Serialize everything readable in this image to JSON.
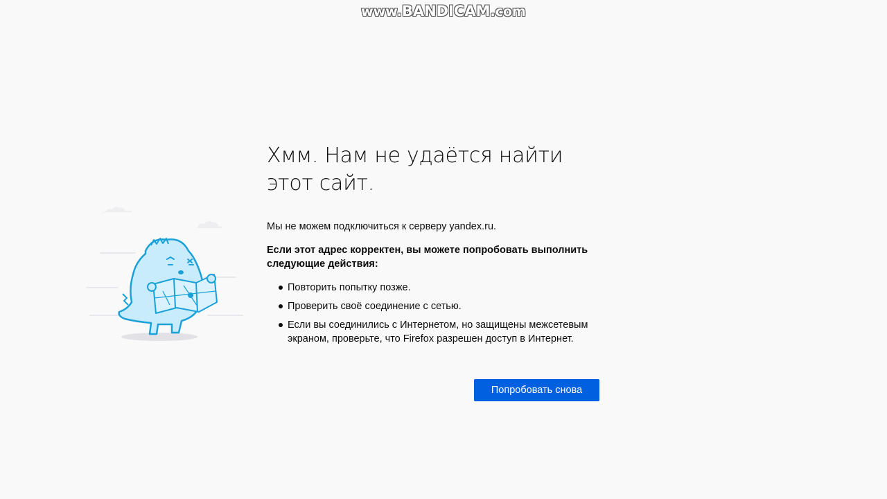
{
  "watermark": {
    "prefix": "www.",
    "brand": "BANDICAM",
    "suffix": ".com"
  },
  "error_page": {
    "title": "Хмм. Нам не удаётся найти этот сайт.",
    "lead": "Мы не можем подключиться к серверу yandex.ru.",
    "advice_heading": "Если этот адрес корректен, вы можете попробовать выполнить следующие действия:",
    "steps": [
      "Повторить попытку позже.",
      "Проверить своё соединение с сетью.",
      "Если вы соединились с Интернетом, но защищены межсетевым экраном, проверьте, что Firefox разрешен доступ в Интернет."
    ],
    "retry_button": "Попробовать снова"
  },
  "colors": {
    "background": "#f9f9fa",
    "button": "#0060df",
    "illustration_fill": "#c8ecfb",
    "illustration_stroke": "#1ba1d8"
  }
}
